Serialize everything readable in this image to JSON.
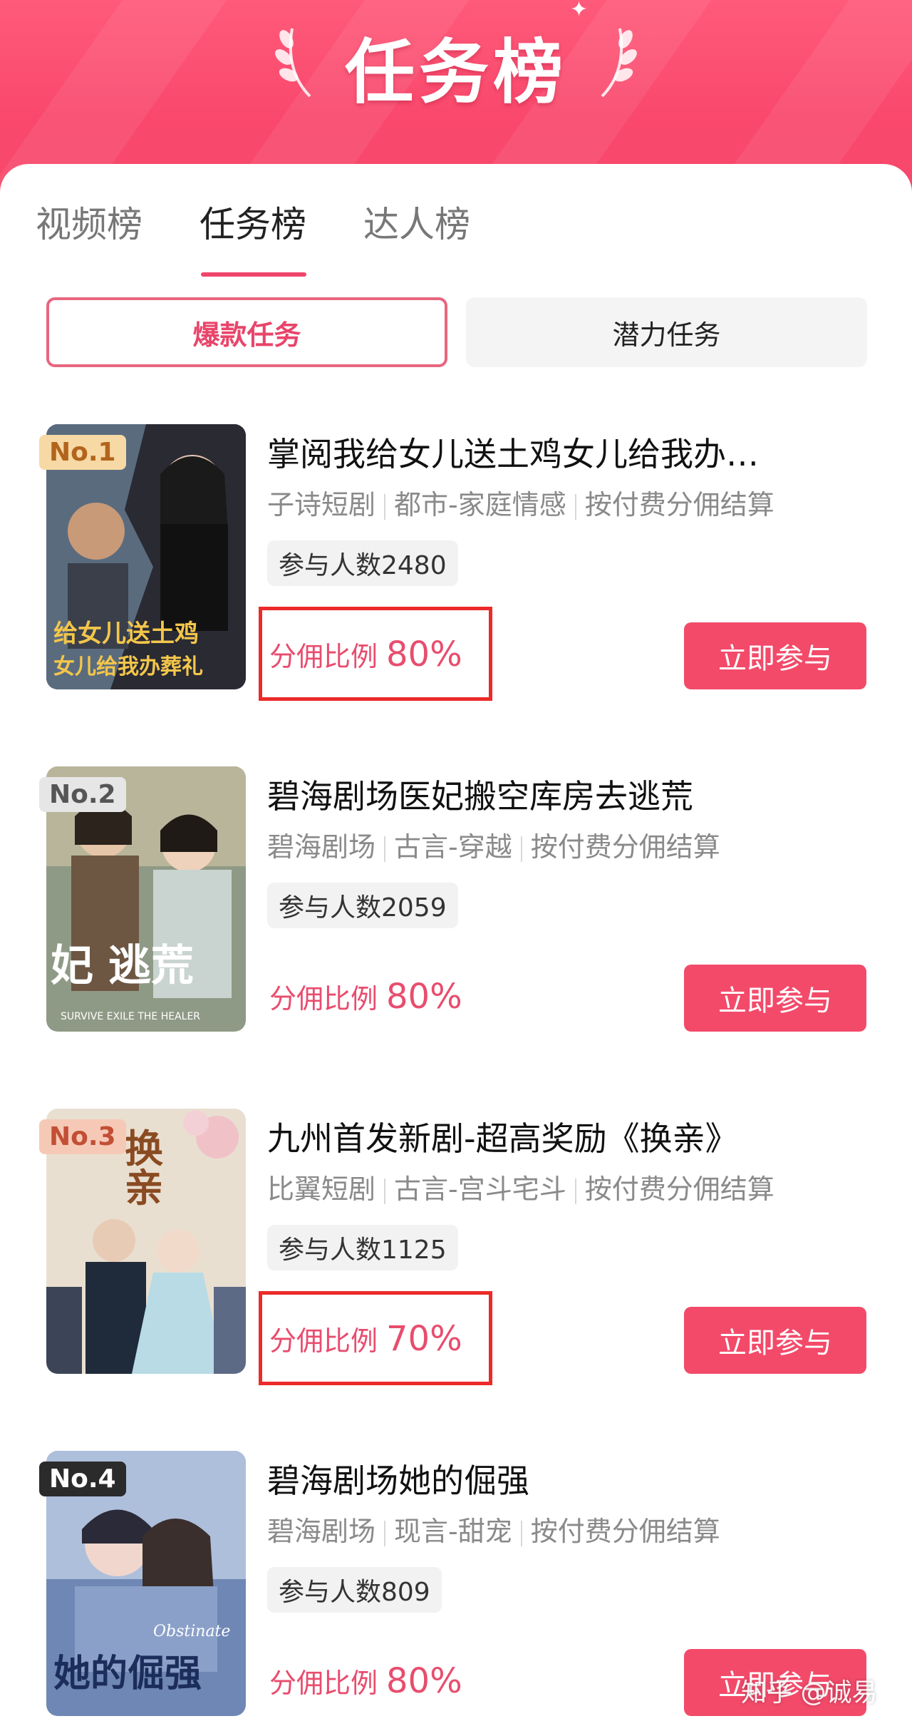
{
  "header": {
    "title": "任务榜"
  },
  "tabs": [
    {
      "label": "视频榜",
      "active": false
    },
    {
      "label": "任务榜",
      "active": true
    },
    {
      "label": "达人榜",
      "active": false
    }
  ],
  "subtabs": [
    {
      "label": "爆款任务",
      "active": true
    },
    {
      "label": "潜力任务",
      "active": false
    }
  ],
  "items": [
    {
      "rank": "No.1",
      "title": "掌阅我给女儿送土鸡女儿给我办…",
      "meta": [
        "子诗短剧",
        "都市-家庭情感",
        "按付费分佣结算"
      ],
      "participants": "参与人数2480",
      "ratio_label": "分佣比例",
      "ratio_value": "80%",
      "button": "立即参与",
      "highlighted": true
    },
    {
      "rank": "No.2",
      "title": "碧海剧场医妃搬空库房去逃荒",
      "meta": [
        "碧海剧场",
        "古言-穿越",
        "按付费分佣结算"
      ],
      "participants": "参与人数2059",
      "ratio_label": "分佣比例",
      "ratio_value": "80%",
      "button": "立即参与",
      "highlighted": false
    },
    {
      "rank": "No.3",
      "title": "九州首发新剧-超高奖励《换亲》",
      "meta": [
        "比翼短剧",
        "古言-宫斗宅斗",
        "按付费分佣结算"
      ],
      "participants": "参与人数1125",
      "ratio_label": "分佣比例",
      "ratio_value": "70%",
      "button": "立即参与",
      "highlighted": true
    },
    {
      "rank": "No.4",
      "title": "碧海剧场她的倔强",
      "meta": [
        "碧海剧场",
        "现言-甜宠",
        "按付费分佣结算"
      ],
      "participants": "参与人数809",
      "ratio_label": "分佣比例",
      "ratio_value": "80%",
      "button": "立即参与",
      "highlighted": false
    }
  ],
  "watermark": "知乎 @诚易",
  "colors": {
    "accent": "#f34a6a",
    "banner": "#f9486c",
    "highlight_box": "#ec2a2a"
  }
}
